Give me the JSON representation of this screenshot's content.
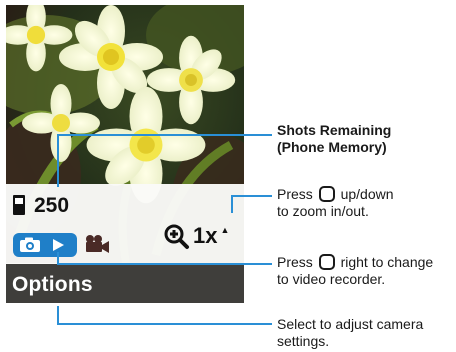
{
  "screen": {
    "shots_remaining": "250",
    "zoom_level": "1x",
    "softkey_label": "Options"
  },
  "icons": {
    "memory": "phone-memory-icon",
    "camera": "camera-icon",
    "play": "play-icon",
    "video": "video-camera-icon",
    "zoom": "zoom-magnifier-icon",
    "zoom_arrow": "up-arrow"
  },
  "callouts": {
    "shots_line1": "Shots Remaining",
    "shots_line2": "(Phone Memory)",
    "zoom_line1_pre": "Press",
    "zoom_line1_post": "up/down",
    "zoom_line2": "to zoom in/out.",
    "mode_line1_pre": "Press",
    "mode_line1_post": "right to change",
    "mode_line2": "to video recorder.",
    "options_line1": "Select to adjust camera",
    "options_line2": "settings."
  },
  "colors": {
    "mode_toggle": "#1f7fc8",
    "callout_line": "#2a8fd6",
    "softkey_bar": "#3f3e3b"
  }
}
